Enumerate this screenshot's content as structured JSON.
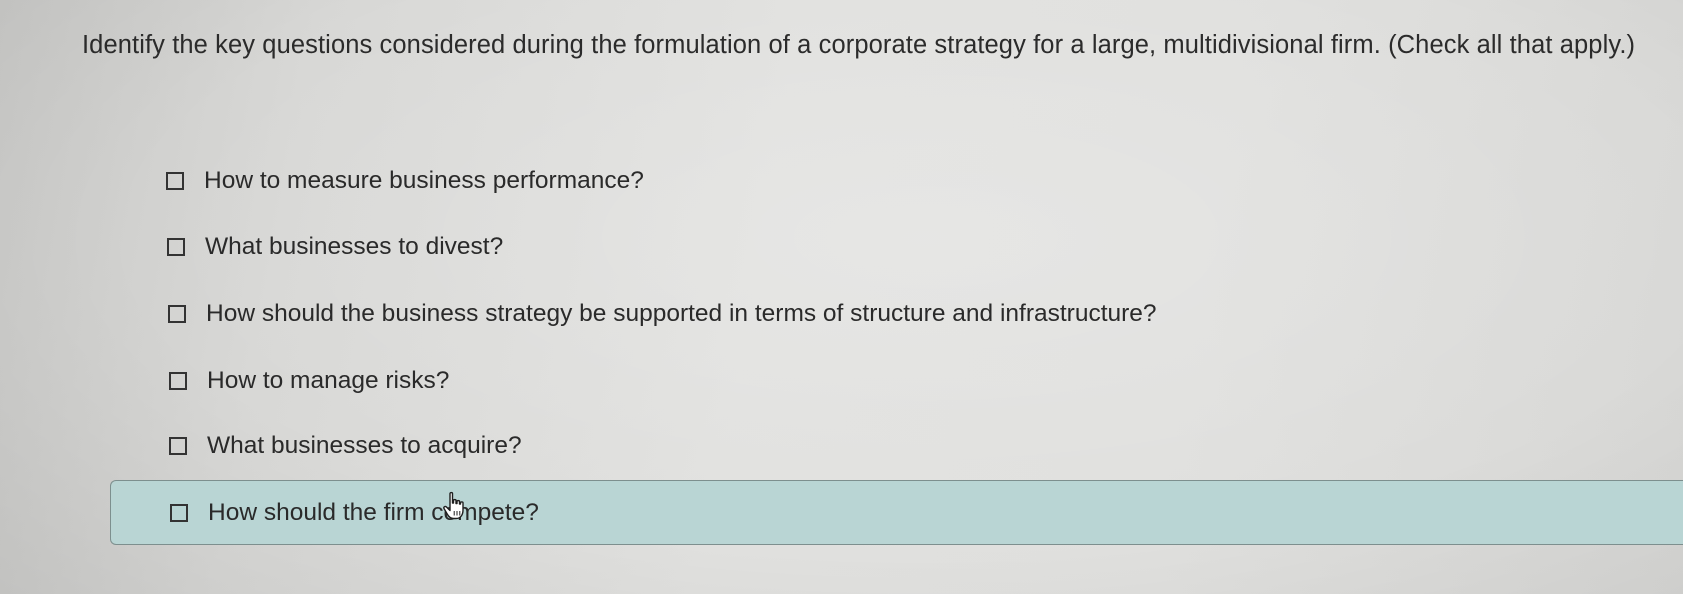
{
  "question": {
    "text": "Identify the key questions considered during the formulation of a corporate strategy for a large, multidivisional firm. (Check all that apply.)"
  },
  "options": [
    {
      "label": "How to measure business performance?",
      "checked": false
    },
    {
      "label": "What businesses to divest?",
      "checked": false
    },
    {
      "label": "How should the business strategy be supported in terms of structure and infrastructure?",
      "checked": false
    },
    {
      "label": "How to manage risks?",
      "checked": false
    },
    {
      "label": "What businesses to acquire?",
      "checked": false
    },
    {
      "label": "How should the firm compete?",
      "checked": false,
      "hovered": true
    }
  ],
  "colors": {
    "hover_highlight": "#b9d5d4",
    "text": "#2b2b2b"
  },
  "icons": {
    "pointer": "hand-pointer-icon"
  }
}
